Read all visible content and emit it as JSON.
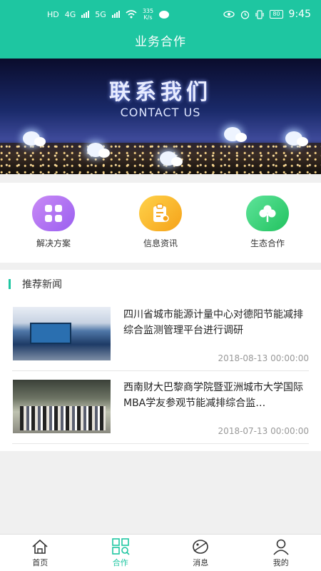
{
  "status_bar": {
    "left_labels": [
      "HD",
      "4G",
      "5G"
    ],
    "net_speed_value": "335",
    "net_speed_unit": "K/s",
    "battery": "80",
    "time": "9:45"
  },
  "header": {
    "title": "业务合作"
  },
  "banner": {
    "title_cn": "联系我们",
    "title_en": "CONTACT US"
  },
  "quick_menu": [
    {
      "label": "解决方案",
      "icon": "grid-icon",
      "color": "#a66ff2"
    },
    {
      "label": "信息资讯",
      "icon": "clipboard-icon",
      "color": "#f7b52c"
    },
    {
      "label": "生态合作",
      "icon": "clover-icon",
      "color": "#2fcc6b"
    }
  ],
  "news": {
    "section_title": "推荐新闻",
    "items": [
      {
        "title": "四川省城市能源计量中心对德阳节能减排综合监测管理平台进行调研",
        "date": "2018-08-13 00:00:00"
      },
      {
        "title": "西南财大巴黎商学院暨亚洲城市大学国际MBA学友参观节能减排综合监…",
        "date": "2018-07-13 00:00:00"
      }
    ]
  },
  "tabbar": {
    "items": [
      {
        "label": "首页",
        "icon": "home-icon"
      },
      {
        "label": "合作",
        "icon": "cooperation-grid-icon"
      },
      {
        "label": "消息",
        "icon": "message-icon"
      },
      {
        "label": "我的",
        "icon": "user-icon"
      }
    ],
    "active": "合作",
    "active_color": "#1ec6a1"
  },
  "colors": {
    "primary": "#1ec6a1"
  }
}
